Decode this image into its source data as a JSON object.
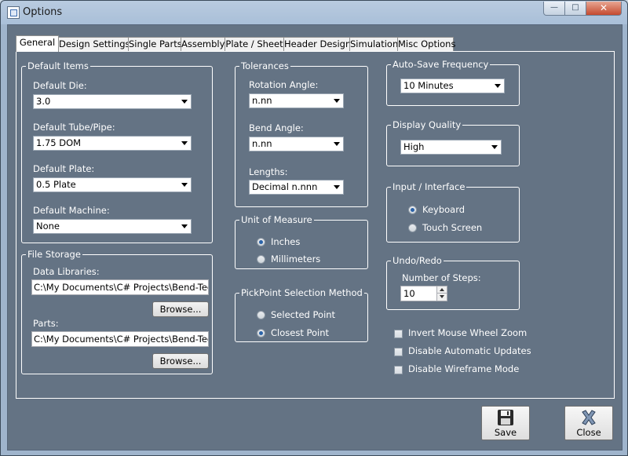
{
  "window": {
    "title": "Options",
    "minimize": "—",
    "maximize": "□",
    "close": "✕"
  },
  "tabs": [
    "General",
    "Design Settings",
    "Single Parts",
    "Assembly",
    "Plate / Sheet",
    "Header Design",
    "Simulation",
    "Misc Options"
  ],
  "default_items": {
    "legend": "Default Items",
    "die_label": "Default Die:",
    "die_value": "3.0",
    "tube_label": "Default Tube/Pipe:",
    "tube_value": "1.75 DOM",
    "plate_label": "Default Plate:",
    "plate_value": "0.5 Plate",
    "machine_label": "Default Machine:",
    "machine_value": "None"
  },
  "file_storage": {
    "legend": "File Storage",
    "data_label": "Data Libraries:",
    "data_value": "C:\\My Documents\\C# Projects\\Bend-Tech\\Be",
    "parts_label": "Parts:",
    "parts_value": "C:\\My Documents\\C# Projects\\Bend-Tech\\Be",
    "browse": "Browse..."
  },
  "tolerances": {
    "legend": "Tolerances",
    "rotation_label": "Rotation Angle:",
    "rotation_value": "n.nn",
    "bend_label": "Bend Angle:",
    "bend_value": "n.nn",
    "lengths_label": "Lengths:",
    "lengths_value": "Decimal n.nnn"
  },
  "unit_of_measure": {
    "legend": "Unit of Measure",
    "inches": "Inches",
    "millimeters": "Millimeters",
    "selected": "Inches"
  },
  "pickpoint": {
    "legend": "PickPoint Selection Method",
    "selected_point": "Selected Point",
    "closest_point": "Closest Point",
    "selected": "Closest Point"
  },
  "autosave": {
    "legend": "Auto-Save Frequency",
    "value": "10 Minutes"
  },
  "display_quality": {
    "legend": "Display Quality",
    "value": "High"
  },
  "input_interface": {
    "legend": "Input / Interface",
    "keyboard": "Keyboard",
    "touch": "Touch Screen",
    "selected": "Keyboard"
  },
  "undo_redo": {
    "legend": "Undo/Redo",
    "steps_label": "Number of Steps:",
    "steps_value": "10"
  },
  "checkboxes": {
    "invert_zoom": "Invert Mouse Wheel Zoom",
    "disable_updates": "Disable Automatic Updates",
    "disable_wireframe": "Disable Wireframe Mode"
  },
  "footer": {
    "save": "Save",
    "close": "Close"
  },
  "colors": {
    "panel": "#647384",
    "accent": "#2a62a8"
  }
}
